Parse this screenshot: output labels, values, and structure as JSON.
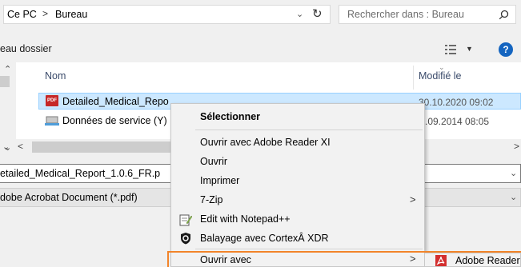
{
  "address_bar": {
    "crumbs": [
      "Ce PC",
      "Bureau"
    ],
    "separator": ">"
  },
  "search": {
    "placeholder": "Rechercher dans : Bureau"
  },
  "toolbar": {
    "label": "eau dossier",
    "help_label": "?"
  },
  "file_list": {
    "columns": {
      "name": "Nom",
      "modified": "Modifié le"
    },
    "rows": [
      {
        "name": "Detailed_Medical_Report_1.0.6_FR.pdf",
        "visible_name": "Detailed_Medical_Repo",
        "date": "30.10.2020 09:02",
        "visible_date": "30.10.2020 09:02",
        "icon": "pdf-icon",
        "selected": true
      },
      {
        "name": "Données de service (Y)",
        "visible_name": "Données de service (Y)",
        "date": ".09.2014 08:05",
        "visible_date": ".09.2014 08:05",
        "icon": "network-folder-icon",
        "selected": false
      }
    ]
  },
  "file_name_field": {
    "value": "etailed_Medical_Report_1.0.6_FR.p"
  },
  "file_type_field": {
    "value": "dobe Acrobat Document (*.pdf)"
  },
  "context_menu": {
    "items": [
      {
        "label": "Sélectionner",
        "bold": true
      },
      {
        "label": "Ouvrir avec Adobe Reader XI"
      },
      {
        "label": "Ouvrir"
      },
      {
        "label": "Imprimer"
      },
      {
        "label": "7-Zip",
        "submenu": true
      },
      {
        "label": "Edit with Notepad++",
        "icon": "notepad-icon"
      },
      {
        "label": "Balayage avec CortexÂ XDR",
        "icon": "shield-icon"
      },
      {
        "label": "Ouvrir avec",
        "submenu": true
      }
    ],
    "submenu_item": {
      "label": "Adobe Reader",
      "icon": "adobe-reader-icon"
    }
  },
  "colors": {
    "highlight": "#f2842a",
    "selection": "#cce8ff",
    "help": "#1565c0"
  }
}
